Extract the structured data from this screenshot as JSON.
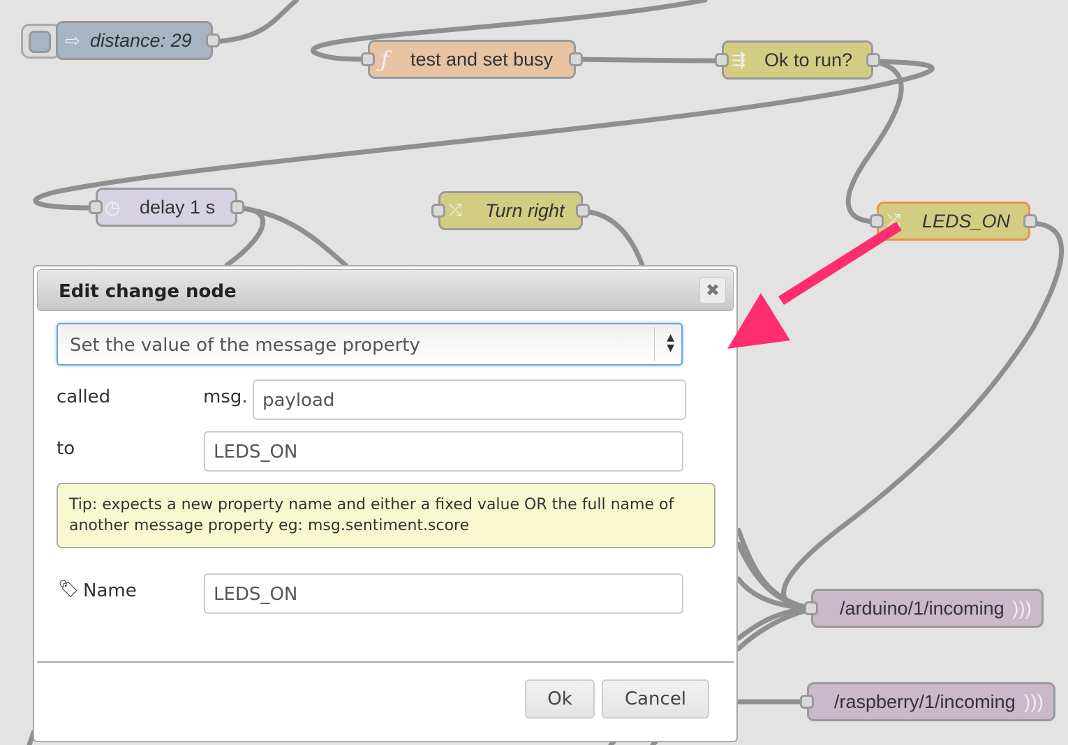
{
  "canvas": {
    "nodes": [
      {
        "id": "distance",
        "label": "distance: 29",
        "type": "inject",
        "icon": "inject-arrow-icon",
        "color": "#a6b4c4"
      },
      {
        "id": "test-and-set",
        "label": "test and set busy",
        "type": "function",
        "icon": "function-icon",
        "color": "#e7c3a4"
      },
      {
        "id": "ok-to-run",
        "label": "Ok to run?",
        "type": "switch",
        "icon": "switch-icon",
        "color": "#d3cd83"
      },
      {
        "id": "delay",
        "label": "delay 1 s",
        "type": "delay",
        "icon": "timer-icon",
        "color": "#d6d2e3"
      },
      {
        "id": "turn-right",
        "label": "Turn right",
        "type": "change",
        "icon": "shuffle-icon",
        "color": "#d3cd83"
      },
      {
        "id": "leds-on",
        "label": "LEDS_ON",
        "type": "change",
        "icon": "shuffle-icon",
        "color": "#d3cd83",
        "selected": true,
        "highlight": "#e8924a"
      },
      {
        "id": "arduino",
        "label": "/arduino/1/incoming",
        "type": "mqtt-out",
        "icon": "wifi-icon",
        "color": "#cbb8c9"
      },
      {
        "id": "raspberry",
        "label": "/raspberry/1/incoming",
        "type": "mqtt-out",
        "icon": "wifi-icon",
        "color": "#cbb8c9"
      }
    ],
    "annotation_arrow_color": "#ff2d6f"
  },
  "dialog": {
    "title": "Edit change node",
    "close_label": "✖",
    "action_select": {
      "value": "Set the value of the message property"
    },
    "called_label": "called",
    "msg_prefix": "msg.",
    "called_value": "payload",
    "to_label": "to",
    "to_value": "LEDS_ON",
    "tip": "Tip: expects a new property name and either a fixed value OR the full name of another message property eg: msg.sentiment.score",
    "name_label": "Name",
    "name_value": "LEDS_ON",
    "ok_label": "Ok",
    "cancel_label": "Cancel"
  }
}
